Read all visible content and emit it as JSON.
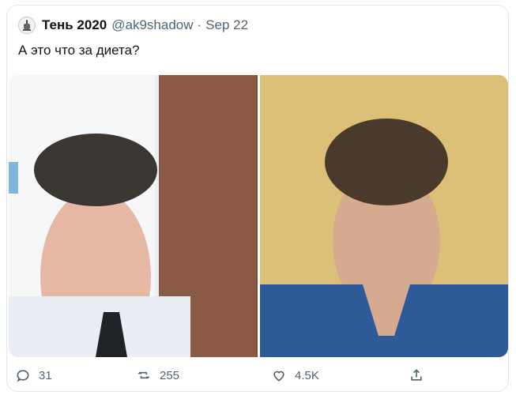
{
  "tweet": {
    "author_name": "Тень 2020",
    "handle": "@ak9shadow",
    "separator": "·",
    "date": "Sep 22",
    "text": "А это что за диета?"
  },
  "media": {
    "count": 2,
    "left_image": "portrait-photo",
    "right_image": "portrait-photo"
  },
  "actions": {
    "replies": "31",
    "retweets": "255",
    "likes": "4.5K"
  },
  "colors": {
    "text": "#0f1419",
    "muted": "#536471",
    "border": "#e1e8ed"
  }
}
